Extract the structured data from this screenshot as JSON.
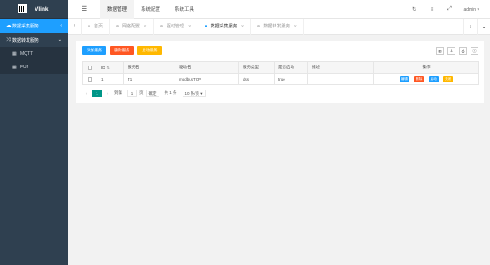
{
  "app": {
    "title": "Vlink"
  },
  "sidebar": {
    "items": [
      {
        "label": "数据采集服务",
        "icon": "cloud-icon",
        "active": true
      },
      {
        "label": "数据转发服务",
        "icon": "shuffle-icon",
        "active": false
      }
    ],
    "sub_items": [
      {
        "label": "MQTT",
        "icon": "grid-icon"
      },
      {
        "label": "FUJ",
        "icon": "grid-icon"
      }
    ]
  },
  "header": {
    "tabs": [
      "数据管理",
      "系统配置",
      "系统工具"
    ],
    "active_tab": "数据管理",
    "user": "admin"
  },
  "page_tabs": [
    {
      "label": "首页",
      "active": false
    },
    {
      "label": "网络配置",
      "active": false
    },
    {
      "label": "驱动管理",
      "active": false
    },
    {
      "label": "数据采集服务",
      "active": true
    },
    {
      "label": "数据转发服务",
      "active": false
    }
  ],
  "toolbar": {
    "add_label": "添加服务",
    "delete_label": "删除服务",
    "start_label": "启动服务"
  },
  "table": {
    "columns": [
      "ID",
      "服务名",
      "驱动名",
      "服务类型",
      "是否启动",
      "描述",
      "操作"
    ],
    "rows": [
      {
        "id": "1",
        "service_name": "T1",
        "driver_name": "modbusTCP",
        "service_type": "dss",
        "enabled": "true",
        "desc": ""
      }
    ],
    "row_actions": {
      "edit": "编辑",
      "delete": "删除",
      "start": "启动",
      "stop": "关闭"
    }
  },
  "pager": {
    "current": "1",
    "goto_label": "到第",
    "goto_value": "1",
    "page_unit": "页",
    "confirm": "确定",
    "total": "共 1 条",
    "page_size": "10 条/页"
  },
  "colors": {
    "sidebar_bg": "#2f4050",
    "accent_blue": "#1e9fff",
    "danger_red": "#ff5722",
    "warn_yellow": "#ffb800",
    "pager_green": "#009688"
  }
}
